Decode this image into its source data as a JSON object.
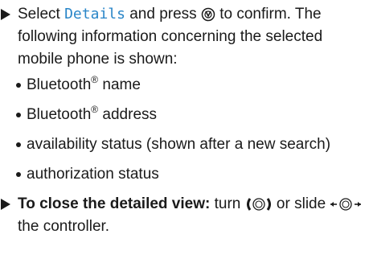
{
  "step1": {
    "text_before": "Select ",
    "menu_item": "Details",
    "text_mid": " and press ",
    "press_icon": "controller-press-icon",
    "text_after": " to confirm. The following information concerning the selected mobile phone is shown:"
  },
  "bullets": [
    {
      "text": "Bluetooth",
      "sup": "®",
      "rest": " name"
    },
    {
      "text": "Bluetooth",
      "sup": "®",
      "rest": " address"
    },
    {
      "text": "availability status (shown after a new search)",
      "sup": "",
      "rest": ""
    },
    {
      "text": "authorization status",
      "sup": "",
      "rest": ""
    }
  ],
  "step2": {
    "heading": "To close the detailed view:",
    "text_turn": " turn ",
    "turn_icon": "controller-turn-icon",
    "text_or": " or slide ",
    "slide_icon": "controller-slide-icon",
    "text_after": " the controller."
  },
  "colors": {
    "menu_item": "#2a86c8",
    "text": "#1a1a1a"
  }
}
